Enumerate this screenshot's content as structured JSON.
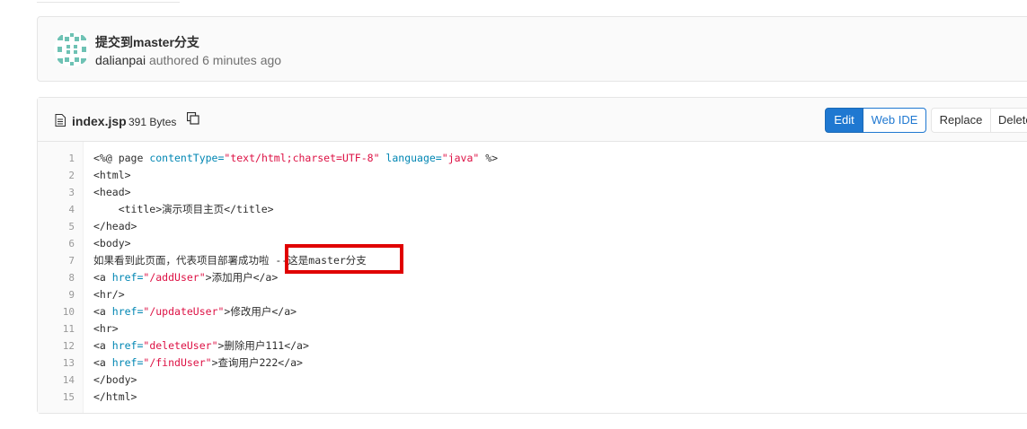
{
  "commit": {
    "title": "提交到master分支",
    "author": "dalianpai",
    "authored_text": "authored 6 minutes ago",
    "avatar_icon": "identicon-avatar"
  },
  "file": {
    "name": "index.jsp",
    "size": "391 Bytes",
    "file_icon": "file-icon",
    "copy_icon": "copy-icon"
  },
  "actions": {
    "edit": "Edit",
    "web_ide": "Web IDE",
    "replace": "Replace",
    "delete": "Delete"
  },
  "code": {
    "line_numbers": [
      "1",
      "2",
      "3",
      "4",
      "5",
      "6",
      "7",
      "8",
      "9",
      "10",
      "11",
      "12",
      "13",
      "14",
      "15"
    ],
    "lines": [
      [
        {
          "t": "<%@ page ",
          "c": "directive"
        },
        {
          "t": "contentType=",
          "c": "attr"
        },
        {
          "t": "\"text/html;charset=UTF-8\"",
          "c": "str"
        },
        {
          "t": " language=",
          "c": "attr"
        },
        {
          "t": "\"java\"",
          "c": "str"
        },
        {
          "t": " %>",
          "c": "directive"
        }
      ],
      [
        {
          "t": "<html>",
          "c": "tag"
        }
      ],
      [
        {
          "t": "<head>",
          "c": "tag"
        }
      ],
      [
        {
          "t": "    <title>",
          "c": "tag"
        },
        {
          "t": "演示项目主页",
          "c": "tag"
        },
        {
          "t": "</title>",
          "c": "tag"
        }
      ],
      [
        {
          "t": "</head>",
          "c": "tag"
        }
      ],
      [
        {
          "t": "<body>",
          "c": "tag"
        }
      ],
      [
        {
          "t": "如果看到此页面，代表项目部署成功啦 --这是master分支",
          "c": "tag"
        }
      ],
      [
        {
          "t": "<a ",
          "c": "tag"
        },
        {
          "t": "href=",
          "c": "attr"
        },
        {
          "t": "\"/addUser\"",
          "c": "str"
        },
        {
          "t": ">添加用户</a>",
          "c": "tag"
        }
      ],
      [
        {
          "t": "<hr/>",
          "c": "tag"
        }
      ],
      [
        {
          "t": "<a ",
          "c": "tag"
        },
        {
          "t": "href=",
          "c": "attr"
        },
        {
          "t": "\"/updateUser\"",
          "c": "str"
        },
        {
          "t": ">修改用户</a>",
          "c": "tag"
        }
      ],
      [
        {
          "t": "<hr>",
          "c": "tag"
        }
      ],
      [
        {
          "t": "<a ",
          "c": "tag"
        },
        {
          "t": "href=",
          "c": "attr"
        },
        {
          "t": "\"deleteUser\"",
          "c": "str"
        },
        {
          "t": ">删除用户111</a>",
          "c": "tag"
        }
      ],
      [
        {
          "t": "<a ",
          "c": "tag"
        },
        {
          "t": "href=",
          "c": "attr"
        },
        {
          "t": "\"/findUser\"",
          "c": "str"
        },
        {
          "t": ">查询用户222</a>",
          "c": "tag"
        }
      ],
      [
        {
          "t": "</body>",
          "c": "tag"
        }
      ],
      [
        {
          "t": "</html>",
          "c": "tag"
        }
      ]
    ]
  },
  "colors": {
    "accent": "#1f78d1",
    "highlight_border": "#e00000",
    "string": "#dd1144",
    "attribute": "#0086b3"
  }
}
